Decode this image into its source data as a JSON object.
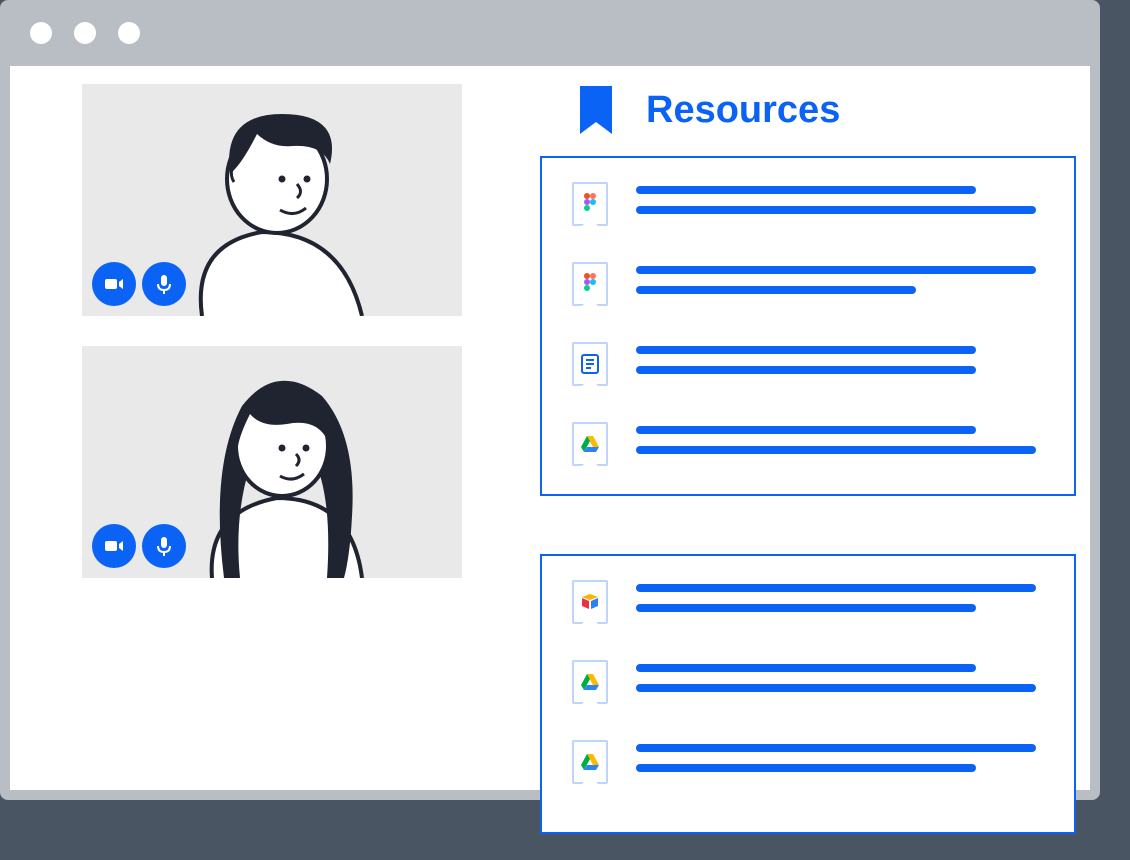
{
  "header": {
    "title": "Resources"
  },
  "colors": {
    "accent": "#0b63f6",
    "tile": "#e9e9e9",
    "iconBorder": "#bfd4fb",
    "chrome": "#b9bec5"
  },
  "participants": [
    {
      "id": "participant-1",
      "camera": true,
      "mic": true
    },
    {
      "id": "participant-2",
      "camera": true,
      "mic": true
    }
  ],
  "panels": [
    {
      "items": [
        {
          "icon": "figma",
          "lineWidths": [
            340,
            400
          ]
        },
        {
          "icon": "figma",
          "lineWidths": [
            400,
            280
          ]
        },
        {
          "icon": "doc",
          "lineWidths": [
            340,
            340
          ]
        },
        {
          "icon": "drive",
          "lineWidths": [
            340,
            400
          ]
        }
      ]
    },
    {
      "items": [
        {
          "icon": "airtable",
          "lineWidths": [
            400,
            340
          ]
        },
        {
          "icon": "drive",
          "lineWidths": [
            340,
            400
          ]
        },
        {
          "icon": "drive",
          "lineWidths": [
            400,
            340
          ]
        }
      ]
    }
  ]
}
